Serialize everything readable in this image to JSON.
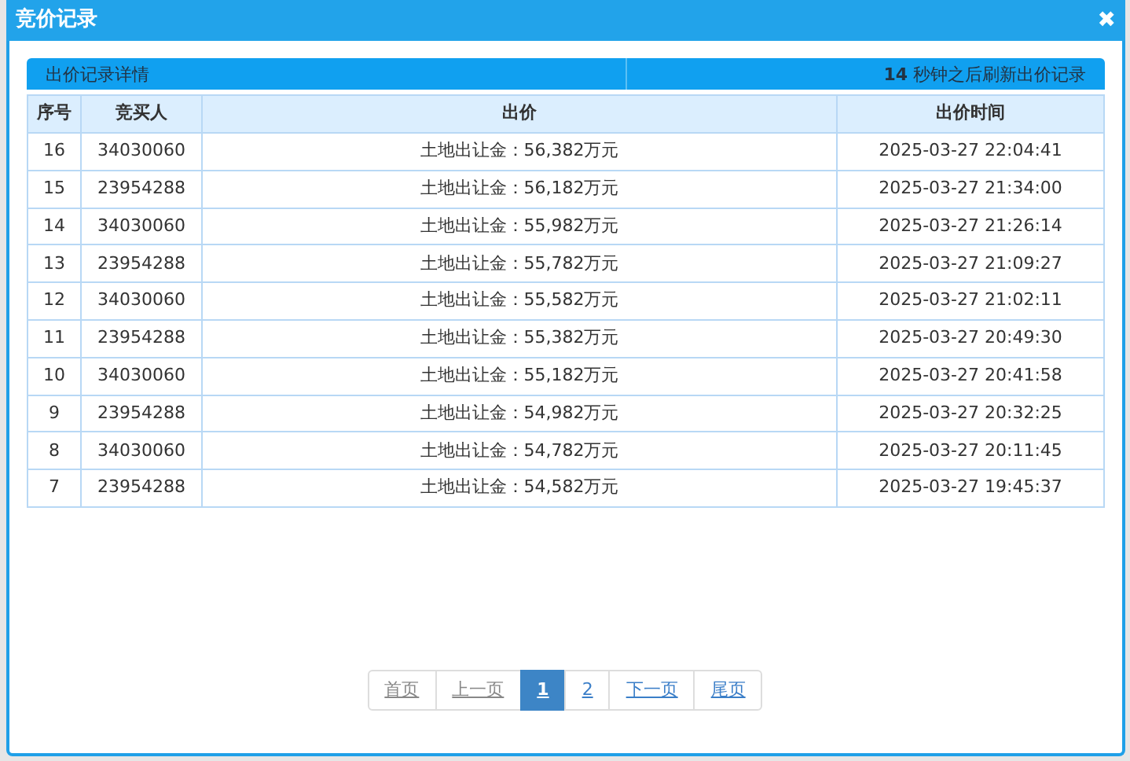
{
  "dialog": {
    "title": "竞价记录",
    "close": "✖"
  },
  "info_bar": {
    "left": "出价记录详情",
    "right": "**14** 秒钟之后刷新出价记录"
  },
  "table": {
    "columns": [
      "序号",
      "竞买人",
      "出价",
      "出价时间"
    ],
    "rows": [
      [
        "16",
        "34030060",
        "土地出让金：56,382万元",
        "2025-03-27 22:04:41"
      ],
      [
        "15",
        "23954288",
        "土地出让金：56,182万元",
        "2025-03-27 21:34:00"
      ],
      [
        "14",
        "34030060",
        "土地出让金：55,982万元",
        "2025-03-27 21:26:14"
      ],
      [
        "13",
        "23954288",
        "土地出让金：55,782万元",
        "2025-03-27 21:09:27"
      ],
      [
        "12",
        "34030060",
        "土地出让金：55,582万元",
        "2025-03-27 21:02:11"
      ],
      [
        "11",
        "23954288",
        "土地出让金：55,382万元",
        "2025-03-27 20:49:30"
      ],
      [
        "10",
        "34030060",
        "土地出让金：55,182万元",
        "2025-03-27 20:41:58"
      ],
      [
        "9",
        "23954288",
        "土地出让金：54,982万元",
        "2025-03-27 20:32:25"
      ],
      [
        "8",
        "34030060",
        "土地出让金：54,782万元",
        "2025-03-27 20:11:45"
      ],
      [
        "7",
        "23954288",
        "土地出让金：54,582万元",
        "2025-03-27 19:45:37"
      ]
    ]
  },
  "pagination": [
    {
      "label": "首页",
      "selected": false,
      "disabled": true
    },
    {
      "label": "上一页",
      "selected": false,
      "disabled": true
    },
    {
      "label": "1",
      "selected": true,
      "disabled": false
    },
    {
      "label": "2",
      "selected": false,
      "disabled": false
    },
    {
      "label": "下一页",
      "selected": false,
      "disabled": false
    },
    {
      "label": "尾页",
      "selected": false,
      "disabled": false
    }
  ]
}
